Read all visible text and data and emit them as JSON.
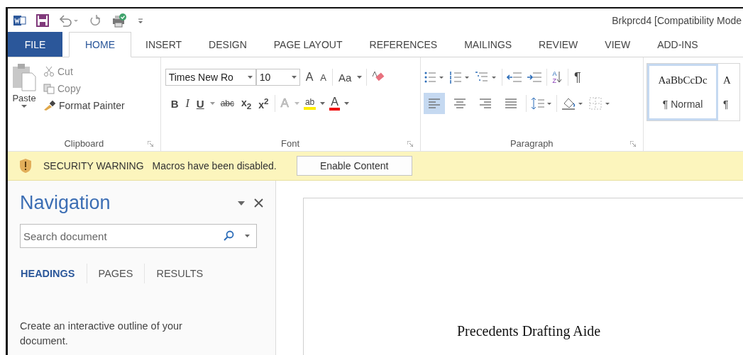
{
  "window": {
    "title": "Brkprcd4 [Compatibility Mode"
  },
  "tabs": [
    {
      "label": "FILE",
      "kind": "file",
      "selected": false
    },
    {
      "label": "HOME",
      "kind": "tab",
      "selected": true
    },
    {
      "label": "INSERT",
      "kind": "tab",
      "selected": false
    },
    {
      "label": "DESIGN",
      "kind": "tab",
      "selected": false
    },
    {
      "label": "PAGE LAYOUT",
      "kind": "tab",
      "selected": false
    },
    {
      "label": "REFERENCES",
      "kind": "tab",
      "selected": false
    },
    {
      "label": "MAILINGS",
      "kind": "tab",
      "selected": false
    },
    {
      "label": "REVIEW",
      "kind": "tab",
      "selected": false
    },
    {
      "label": "VIEW",
      "kind": "tab",
      "selected": false
    },
    {
      "label": "ADD-INS",
      "kind": "tab",
      "selected": false
    }
  ],
  "clipboard": {
    "paste": "Paste",
    "cut": "Cut",
    "copy": "Copy",
    "format_painter": "Format Painter",
    "group": "Clipboard"
  },
  "font": {
    "name": "Times New Ro",
    "size": "10",
    "grow": "A",
    "shrink": "A",
    "change_case": "Aa",
    "bold": "B",
    "italic": "I",
    "underline": "U",
    "strikethrough": "abc",
    "subscript": "x$_{2}$",
    "superscript": "x$^{2}$",
    "text_effects": "A",
    "highlight": "ab",
    "font_color": "A",
    "group": "Font"
  },
  "paragraph": {
    "sort_top": "A",
    "sort_bottom": "Z",
    "show_marks": "¶",
    "group": "Paragraph",
    "alignments": [
      {
        "kind": "left",
        "selected": true
      },
      {
        "kind": "center",
        "selected": false
      },
      {
        "kind": "right",
        "selected": false
      },
      {
        "kind": "justify",
        "selected": false
      }
    ]
  },
  "styles": [
    {
      "preview": "AaBbCcDc",
      "name": "¶ Normal",
      "selected": true
    },
    {
      "preview": "A",
      "name": "¶",
      "selected": false
    }
  ],
  "message_bar": {
    "title": "SECURITY WARNING",
    "message": "Macros have been disabled.",
    "button": "Enable Content"
  },
  "navigation": {
    "title": "Navigation",
    "search_placeholder": "Search document",
    "hint": "Create an interactive outline of your document.",
    "tabs": [
      {
        "label": "HEADINGS",
        "selected": true
      },
      {
        "label": "PAGES",
        "selected": false
      },
      {
        "label": "RESULTS",
        "selected": false
      }
    ]
  },
  "document": {
    "text": "Precedents Drafting Aide"
  }
}
